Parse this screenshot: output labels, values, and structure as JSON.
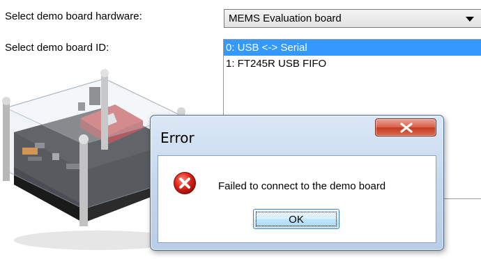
{
  "hardware": {
    "label": "Select demo board hardware:",
    "selected": "MEMS Evaluation board"
  },
  "board_id": {
    "label": "Select demo board ID:",
    "items": [
      "0: USB <-> Serial",
      "1: FT245R USB FIFO"
    ],
    "selected_index": 0
  },
  "dialog": {
    "title": "Error",
    "message": "Failed to connect to the demo board",
    "ok_label": "OK",
    "icon": "error-icon"
  },
  "colors": {
    "selection": "#3399ff",
    "close_button": "#c63b20",
    "dialog_frame": "#c2d6ec"
  }
}
